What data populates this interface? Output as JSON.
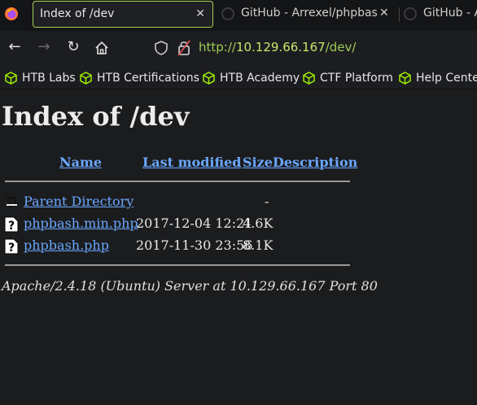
{
  "tabs": [
    {
      "title": "Index of /dev",
      "active": true
    },
    {
      "title": "GitHub - Arrexel/phpbash",
      "active": false
    },
    {
      "title": "GitHub - A",
      "active": false
    }
  ],
  "url": {
    "scheme": "http://",
    "host": "10.129.66.167",
    "path": "/dev/"
  },
  "bookmarks": [
    "HTB Labs",
    "HTB Certifications",
    "HTB Academy",
    "CTF Platform",
    "Help Center"
  ],
  "page": {
    "title": "Index of /dev",
    "columns": {
      "name": "Name",
      "last_modified": "Last modified",
      "size": "Size",
      "description": "Description"
    },
    "rows": [
      {
        "name": "Parent Directory",
        "date": "",
        "size": "-",
        "icon": "back-icon"
      },
      {
        "name": "phpbash.min.php",
        "date": "2017-12-04 12:21",
        "size": "4.6K",
        "icon": "unknown-file-icon"
      },
      {
        "name": "phpbash.php",
        "date": "2017-11-30 23:56",
        "size": "8.1K",
        "icon": "unknown-file-icon"
      }
    ],
    "address": "Apache/2.4.18 (Ubuntu) Server at 10.129.66.167 Port 80"
  },
  "colors": {
    "accent": "#a3d24f",
    "link": "#6aa7ff",
    "url": "#9fcc55",
    "background": "#1b1c1e"
  }
}
